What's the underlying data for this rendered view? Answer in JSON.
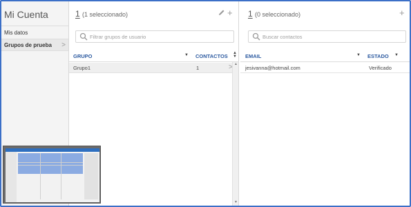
{
  "left_panel": {
    "title": "Mi Cuenta",
    "items": [
      {
        "label": "Mis datos",
        "active": false
      },
      {
        "label": "Grupos de prueba",
        "active": true
      }
    ]
  },
  "groups_panel": {
    "count": "1",
    "selected_text": "(1 seleccionado)",
    "search_placeholder": "Filtrar grupos de usuario",
    "columns": [
      "GRUPO",
      "CONTACTOS"
    ],
    "rows": [
      {
        "grupo": "Grupo1",
        "contactos": "1"
      }
    ],
    "icons": [
      "pencil-icon",
      "plus-icon"
    ]
  },
  "contacts_panel": {
    "count": "1",
    "selected_text": "(0 seleccionado)",
    "search_placeholder": "Buscar contactos",
    "columns": [
      "EMAIL",
      "ESTADO"
    ],
    "rows": [
      {
        "email": "jesivanna@hotmail.com",
        "estado": "Verificado"
      }
    ],
    "icons": [
      "plus-icon"
    ]
  },
  "colors": {
    "accent_blue": "#2c5aa0",
    "frame_blue": "#3b6fc7",
    "selected_row": "#efefef"
  }
}
